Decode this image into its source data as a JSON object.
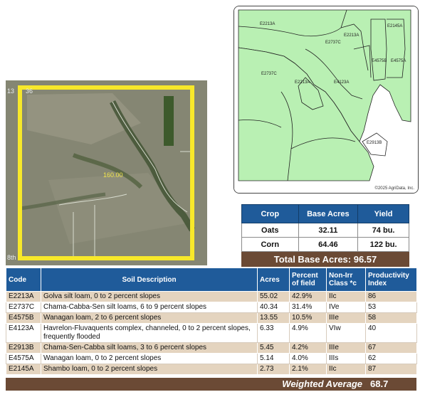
{
  "aerial": {
    "acre_label": "160.00",
    "corner_label_tl": "13",
    "corner_label_tl2": "36",
    "corner_label_bl": "8th"
  },
  "soil_map": {
    "copyright": "©2025 AgriData, Inc.",
    "labels": [
      "E2213A",
      "E2213A",
      "E2737C",
      "E2145A",
      "E4575B",
      "E4575A",
      "E2737C",
      "E2213A",
      "E4123A",
      "E2913B"
    ]
  },
  "crop_table": {
    "headers": [
      "Crop",
      "Base Acres",
      "Yield"
    ],
    "rows": [
      {
        "crop": "Oats",
        "base_acres": "32.11",
        "yield": "74 bu."
      },
      {
        "crop": "Corn",
        "base_acres": "64.46",
        "yield": "122 bu."
      }
    ],
    "total": "Total Base Acres: 96.57"
  },
  "soil_table": {
    "headers": {
      "code": "Code",
      "description": "Soil Description",
      "acres": "Acres",
      "percent": "Percent of field",
      "class": "Non-Irr Class *c",
      "index": "Productivity Index"
    },
    "rows": [
      {
        "code": "E2213A",
        "description": "Golva silt loam, 0 to 2 percent slopes",
        "acres": "55.02",
        "percent": "42.9%",
        "class": "IIc",
        "index": "86"
      },
      {
        "code": "E2737C",
        "description": "Chama-Cabba-Sen silt loams, 6 to 9 percent slopes",
        "acres": "40.34",
        "percent": "31.4%",
        "class": "IVe",
        "index": "53"
      },
      {
        "code": "E4575B",
        "description": "Wanagan loam, 2 to 6 percent slopes",
        "acres": "13.55",
        "percent": "10.5%",
        "class": "IIIe",
        "index": "58"
      },
      {
        "code": "E4123A",
        "description": "Havrelon-Fluvaquents complex, channeled, 0 to 2 percent slopes, frequently flooded",
        "acres": "6.33",
        "percent": "4.9%",
        "class": "VIw",
        "index": "40"
      },
      {
        "code": "E2913B",
        "description": "Chama-Sen-Cabba silt loams, 3 to 6 percent slopes",
        "acres": "5.45",
        "percent": "4.2%",
        "class": "IIIe",
        "index": "67"
      },
      {
        "code": "E4575A",
        "description": "Wanagan loam, 0 to 2 percent slopes",
        "acres": "5.14",
        "percent": "4.0%",
        "class": "IIIs",
        "index": "62"
      },
      {
        "code": "E2145A",
        "description": "Shambo loam, 0 to 2 percent slopes",
        "acres": "2.73",
        "percent": "2.1%",
        "class": "IIc",
        "index": "87"
      }
    ],
    "weighted_label": "Weighted Average",
    "weighted_value": "68.7"
  },
  "colors": {
    "header_blue": "#1f5b9a",
    "footer_brown": "#6b4a35",
    "row_tan": "#e4d4bf",
    "map_green": "#b9f0b3",
    "boundary_yellow": "#f7e82a"
  }
}
